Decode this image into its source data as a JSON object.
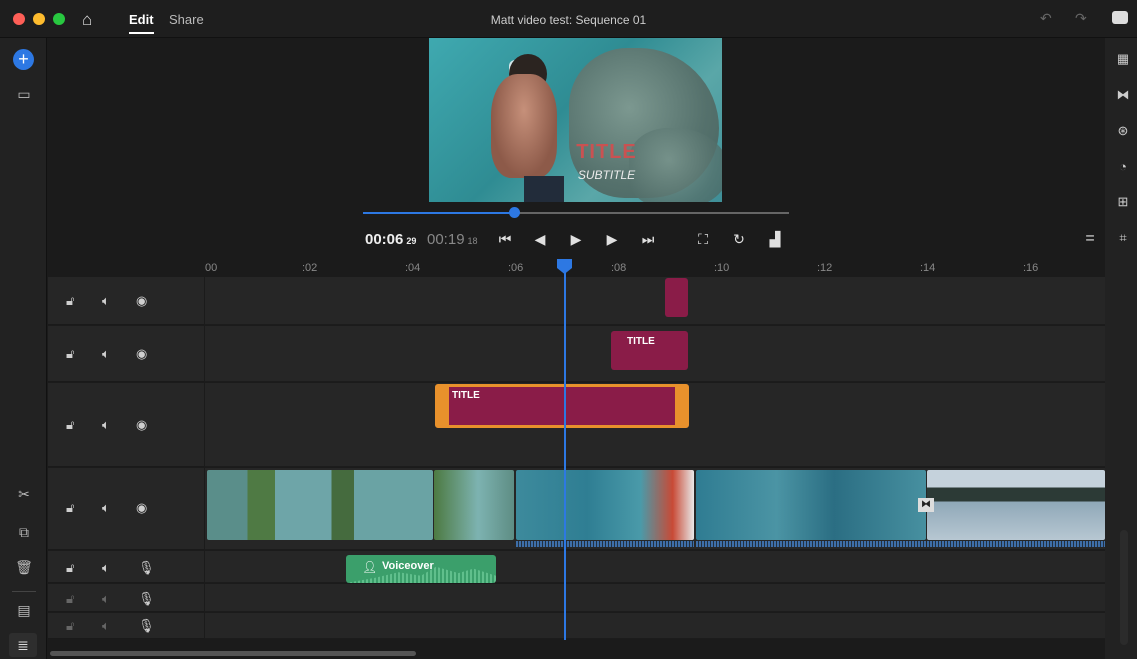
{
  "titlebar": {
    "edit_label": "Edit",
    "share_label": "Share",
    "document_title": "Matt video test: Sequence 01"
  },
  "monitor": {
    "overlay_title": "TITLE",
    "overlay_subtitle": "SUBTITLE",
    "playback_progress": 0.36
  },
  "transport": {
    "current_time": "00:06",
    "current_frames": "29",
    "total_time": "00:19",
    "total_frames": "18"
  },
  "ruler": {
    "ticks": [
      "00",
      ":02",
      ":04",
      ":06",
      ":08",
      ":10",
      ":12",
      ":14",
      ":16"
    ]
  },
  "tracks": {
    "clip2_label": "TITLE",
    "clip3_label": "TITLE",
    "voice_label": "Voiceover"
  },
  "colors": {
    "accent": "#2d78e3",
    "title_clip": "#8a1c48",
    "selected_border": "#e8912c",
    "audio_clip": "#3b9f6b"
  }
}
